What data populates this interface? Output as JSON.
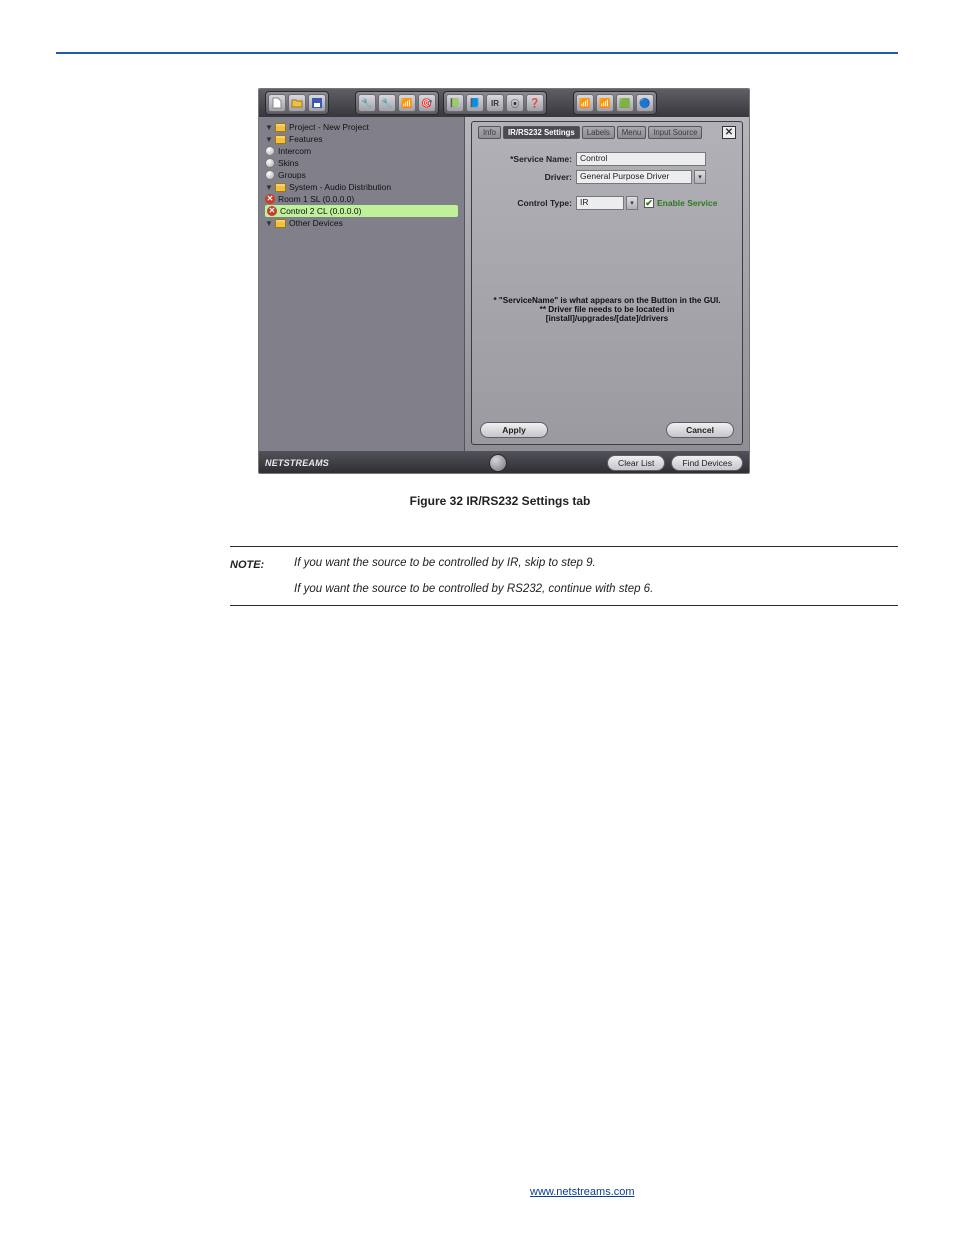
{
  "brand": "NETSTREAMS",
  "tree": {
    "n0": "Project - New Project",
    "n1": "Features",
    "n2": "Intercom",
    "n3": "Skins",
    "n4": "Groups",
    "n5": "System - Audio Distribution",
    "n6": "Room 1 SL (0.0.0.0)",
    "n7": "Control 2 CL (0.0.0.0)",
    "n8": "Other Devices"
  },
  "tabs": [
    "Info",
    "IR/RS232 Settings",
    "Labels",
    "Menu",
    "Input Source"
  ],
  "form": {
    "serviceName": {
      "label": "*Service Name:",
      "value": "Control"
    },
    "driver": {
      "label": "Driver:",
      "value": "General Purpose Driver"
    },
    "controlType": {
      "label": "Control Type:",
      "value": "IR"
    },
    "enableService": "Enable Service"
  },
  "notes": [
    "* \"ServiceName\" is what appears on the Button in the GUI.",
    "** Driver file needs to be located in [install]/upgrades/[date]/drivers"
  ],
  "buttons": {
    "apply": "Apply",
    "cancel": "Cancel",
    "clearList": "Clear List",
    "findDevices": "Find Devices"
  },
  "caption": "Figure 32 IR/RS232 Settings tab",
  "note": {
    "heading": "NOTE:",
    "line1": "If you want the source to be controlled by IR, skip to step 9.",
    "line2": "If you want the source to be controlled by RS232, continue with step 6."
  },
  "footerLink": "www.netstreams.com"
}
